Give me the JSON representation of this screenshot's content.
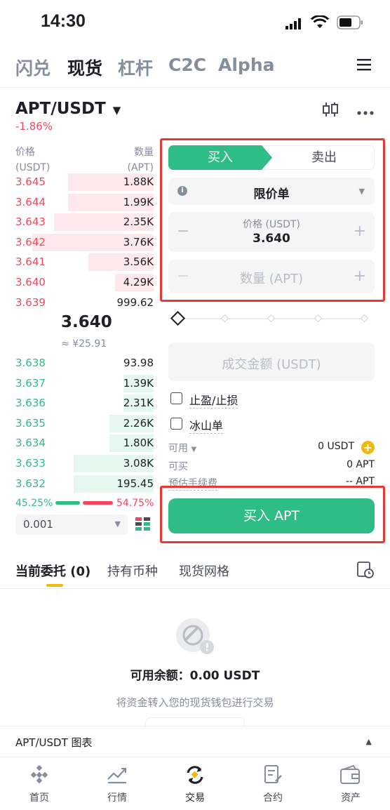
{
  "status_bar": {
    "time": "14:30"
  },
  "nav": {
    "tabs": [
      "闪兑",
      "现货",
      "杠杆",
      "C2C",
      "Alpha"
    ],
    "active": "现货"
  },
  "pair": {
    "name": "APT/USDT",
    "change": "-1.86%"
  },
  "order_book": {
    "price_header": "价格",
    "price_unit": "(USDT)",
    "qty_header": "数量",
    "qty_unit": "(APT)",
    "asks": [
      {
        "price": "3.645",
        "qty": "1.88K",
        "depth": 0.62
      },
      {
        "price": "3.644",
        "qty": "1.99K",
        "depth": 0.62
      },
      {
        "price": "3.643",
        "qty": "2.35K",
        "depth": 0.72
      },
      {
        "price": "3.642",
        "qty": "3.76K",
        "depth": 0.88
      },
      {
        "price": "3.641",
        "qty": "3.56K",
        "depth": 0.47
      },
      {
        "price": "3.640",
        "qty": "4.29K",
        "depth": 0.28
      },
      {
        "price": "3.639",
        "qty": "999.62",
        "depth": 0.0
      }
    ],
    "mid_price": "3.640",
    "mid_fiat": "≈ ¥25.91",
    "bids": [
      {
        "price": "3.638",
        "qty": "93.98",
        "depth": 0.0
      },
      {
        "price": "3.637",
        "qty": "1.39K",
        "depth": 0.22
      },
      {
        "price": "3.636",
        "qty": "2.31K",
        "depth": 0.22
      },
      {
        "price": "3.635",
        "qty": "2.26K",
        "depth": 0.32
      },
      {
        "price": "3.634",
        "qty": "1.80K",
        "depth": 0.32
      },
      {
        "price": "3.633",
        "qty": "3.08K",
        "depth": 0.58
      },
      {
        "price": "3.632",
        "qty": "195.45",
        "depth": 0.58
      }
    ],
    "buy_ratio": "45.25%",
    "sell_ratio": "54.75%",
    "precision": "0.001"
  },
  "order_form": {
    "buy_tab": "买入",
    "sell_tab": "卖出",
    "order_type": "限价单",
    "price_label": "价格 (USDT)",
    "price_value": "3.640",
    "qty_placeholder": "数量 (APT)",
    "total_placeholder": "成交金额 (USDT)",
    "tp_sl": "止盈/止损",
    "iceberg": "冰山单",
    "available_label": "可用",
    "available_value": "0 USDT",
    "can_buy_label": "可买",
    "can_buy_value": "0 APT",
    "fee_label": "预估手续费",
    "fee_value": "-- APT",
    "buy_button": "买入 APT"
  },
  "orders_section": {
    "tabs": [
      "当前委托 (0)",
      "持有币种",
      "现货网格"
    ],
    "balance_text": "可用余额：0.00 USDT",
    "hint": "将资金转入您的现货钱包进行交易"
  },
  "chart_bar": {
    "label": "APT/USDT 图表"
  },
  "bottom_nav": [
    "首页",
    "行情",
    "交易",
    "合约",
    "资产"
  ],
  "colors": {
    "green": "#2ebd85",
    "red": "#f6465d",
    "highlight": "#e53935"
  }
}
